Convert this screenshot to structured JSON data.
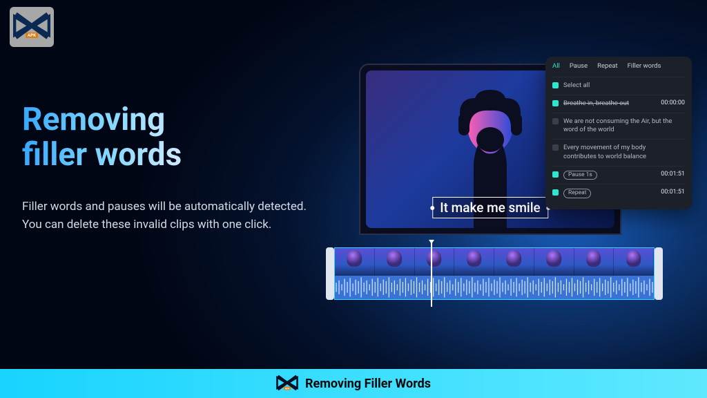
{
  "brand": {
    "logo_label": "APK"
  },
  "hero": {
    "title_line1": "Removing",
    "title_line2": "filler words",
    "description": "Filler words and pauses will be automatically detected. You can delete these invalid clips with one click."
  },
  "caption": {
    "text": "It make me smile"
  },
  "panel": {
    "tabs": {
      "all": "All",
      "pause": "Pause",
      "repeat": "Repeat",
      "filler": "Filler words"
    },
    "select_all": "Select all",
    "items": [
      {
        "checked": true,
        "text": "Breathe in, breathe out",
        "strike": true,
        "time": "00:00:00"
      },
      {
        "checked": false,
        "text": "We are not consuming the Air, but the word of the world",
        "time": ""
      },
      {
        "checked": false,
        "text": "Every movement of my body contributes to world balance",
        "time": ""
      },
      {
        "checked": true,
        "pill": "Pause 1s",
        "time": "00:01:51"
      },
      {
        "checked": true,
        "pill": "Repeat",
        "time": "00:01:51"
      }
    ]
  },
  "footer": {
    "title": "Removing Filler Words",
    "logo_label": "APK"
  }
}
